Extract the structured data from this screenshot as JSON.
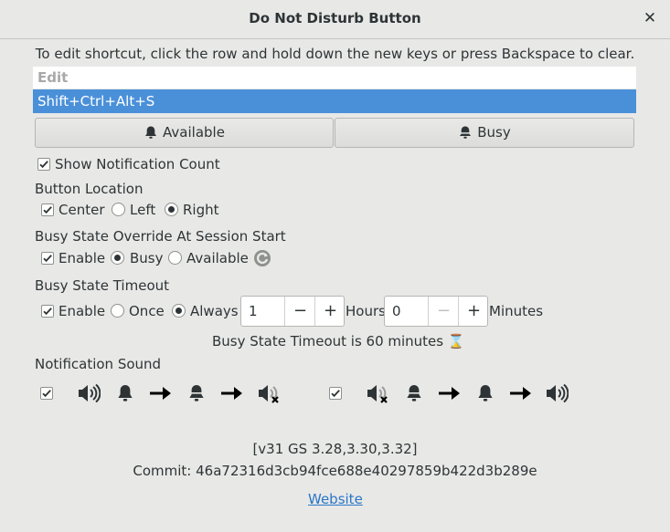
{
  "window": {
    "title": "Do Not Disturb Button",
    "close_glyph": "✕"
  },
  "hint": "To edit shortcut, click the row and hold down the new keys or press Backspace to clear.",
  "shortcut": {
    "header": "Edit",
    "value": "Shift+Ctrl+Alt+S"
  },
  "buttons": {
    "available": "Available",
    "busy": "Busy"
  },
  "show_count": {
    "label": "Show Notification Count",
    "checked": true
  },
  "location": {
    "title": "Button Location",
    "center": "Center",
    "left": "Left",
    "right": "Right",
    "selected": "Right"
  },
  "override": {
    "title": "Busy State Override At Session Start",
    "enable": "Enable",
    "busy": "Busy",
    "available": "Available",
    "selected": "Busy"
  },
  "timeout": {
    "title": "Busy State Timeout",
    "enable": "Enable",
    "once": "Once",
    "always": "Always",
    "selected": "Always",
    "hours_value": "1",
    "hours_label": "Hours",
    "minutes_value": "0",
    "minutes_label": "Minutes",
    "status": "Busy State Timeout is 60 minutes",
    "status_icon": "⌛"
  },
  "sound": {
    "title": "Notification Sound"
  },
  "footer": {
    "version": "[v31  GS 3.28,3.30,3.32]",
    "commit": "Commit: 46a72316d3cb94fce688e40297859b422d3b289e",
    "link": "Website"
  },
  "colors": {
    "accent": "#4a90d9",
    "link": "#2a76c6",
    "background": "#e8e8e7"
  }
}
